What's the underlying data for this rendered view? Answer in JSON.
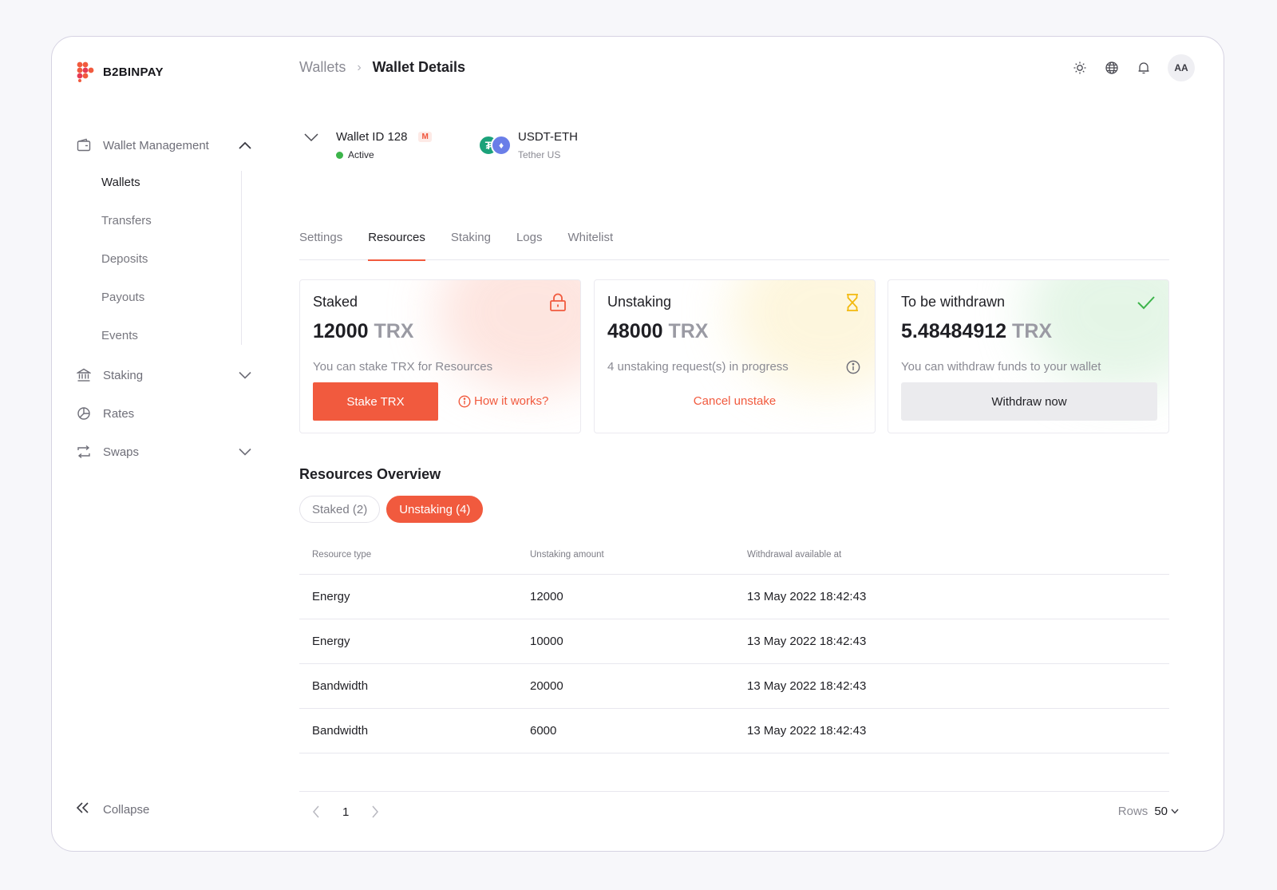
{
  "brand": {
    "name": "B2BINPAY",
    "accent": "#f15a3e"
  },
  "sidebar": {
    "groups": [
      {
        "label": "Wallet Management",
        "icon": "wallet-icon",
        "expanded": true
      },
      {
        "label": "Staking",
        "icon": "bank-icon",
        "expanded": false
      },
      {
        "label": "Rates",
        "icon": "pie-chart-icon"
      },
      {
        "label": "Swaps",
        "icon": "swap-icon",
        "expanded": false
      }
    ],
    "sub_items": [
      "Wallets",
      "Transfers",
      "Deposits",
      "Payouts",
      "Events"
    ],
    "active_sub_item": "Wallets",
    "collapse_label": "Collapse"
  },
  "header": {
    "breadcrumb_parent": "Wallets",
    "breadcrumb_current": "Wallet Details",
    "icons": [
      "sun-icon",
      "globe-icon",
      "bell-icon"
    ],
    "avatar_initials": "AA"
  },
  "wallet": {
    "id_label": "Wallet ID 128",
    "badge": "M",
    "status": "Active",
    "status_color": "#3cb44a",
    "coin_code": "USDT-ETH",
    "coin_name": "Tether US"
  },
  "tabs": [
    "Settings",
    "Resources",
    "Staking",
    "Logs",
    "Whitelist"
  ],
  "active_tab": "Resources",
  "cards": {
    "staked": {
      "title": "Staked",
      "amount": "12000",
      "unit": "TRX",
      "description": "You can stake TRX for Resources",
      "button": "Stake TRX",
      "link": "How it works?"
    },
    "unstaking": {
      "title": "Unstaking",
      "amount": "48000",
      "unit": "TRX",
      "description": "4 unstaking request(s) in progress",
      "link": "Cancel unstake"
    },
    "withdraw": {
      "title": "To be withdrawn",
      "amount": "5.48484912",
      "unit": "TRX",
      "description": "You can withdraw funds to your wallet",
      "button": "Withdraw now"
    }
  },
  "overview": {
    "title": "Resources Overview",
    "filters": [
      {
        "label": "Staked (2)",
        "active": false
      },
      {
        "label": "Unstaking (4)",
        "active": true
      }
    ],
    "columns": [
      "Resource type",
      "Unstaking amount",
      "Withdrawal available at"
    ],
    "rows": [
      [
        "Energy",
        "12000",
        "13 May 2022 18:42:43"
      ],
      [
        "Energy",
        "10000",
        "13 May 2022 18:42:43"
      ],
      [
        "Bandwidth",
        "20000",
        "13 May 2022 18:42:43"
      ],
      [
        "Bandwidth",
        "6000",
        "13 May 2022 18:42:43"
      ]
    ]
  },
  "pagination": {
    "page": "1",
    "rows_label": "Rows",
    "rows_value": "50"
  }
}
